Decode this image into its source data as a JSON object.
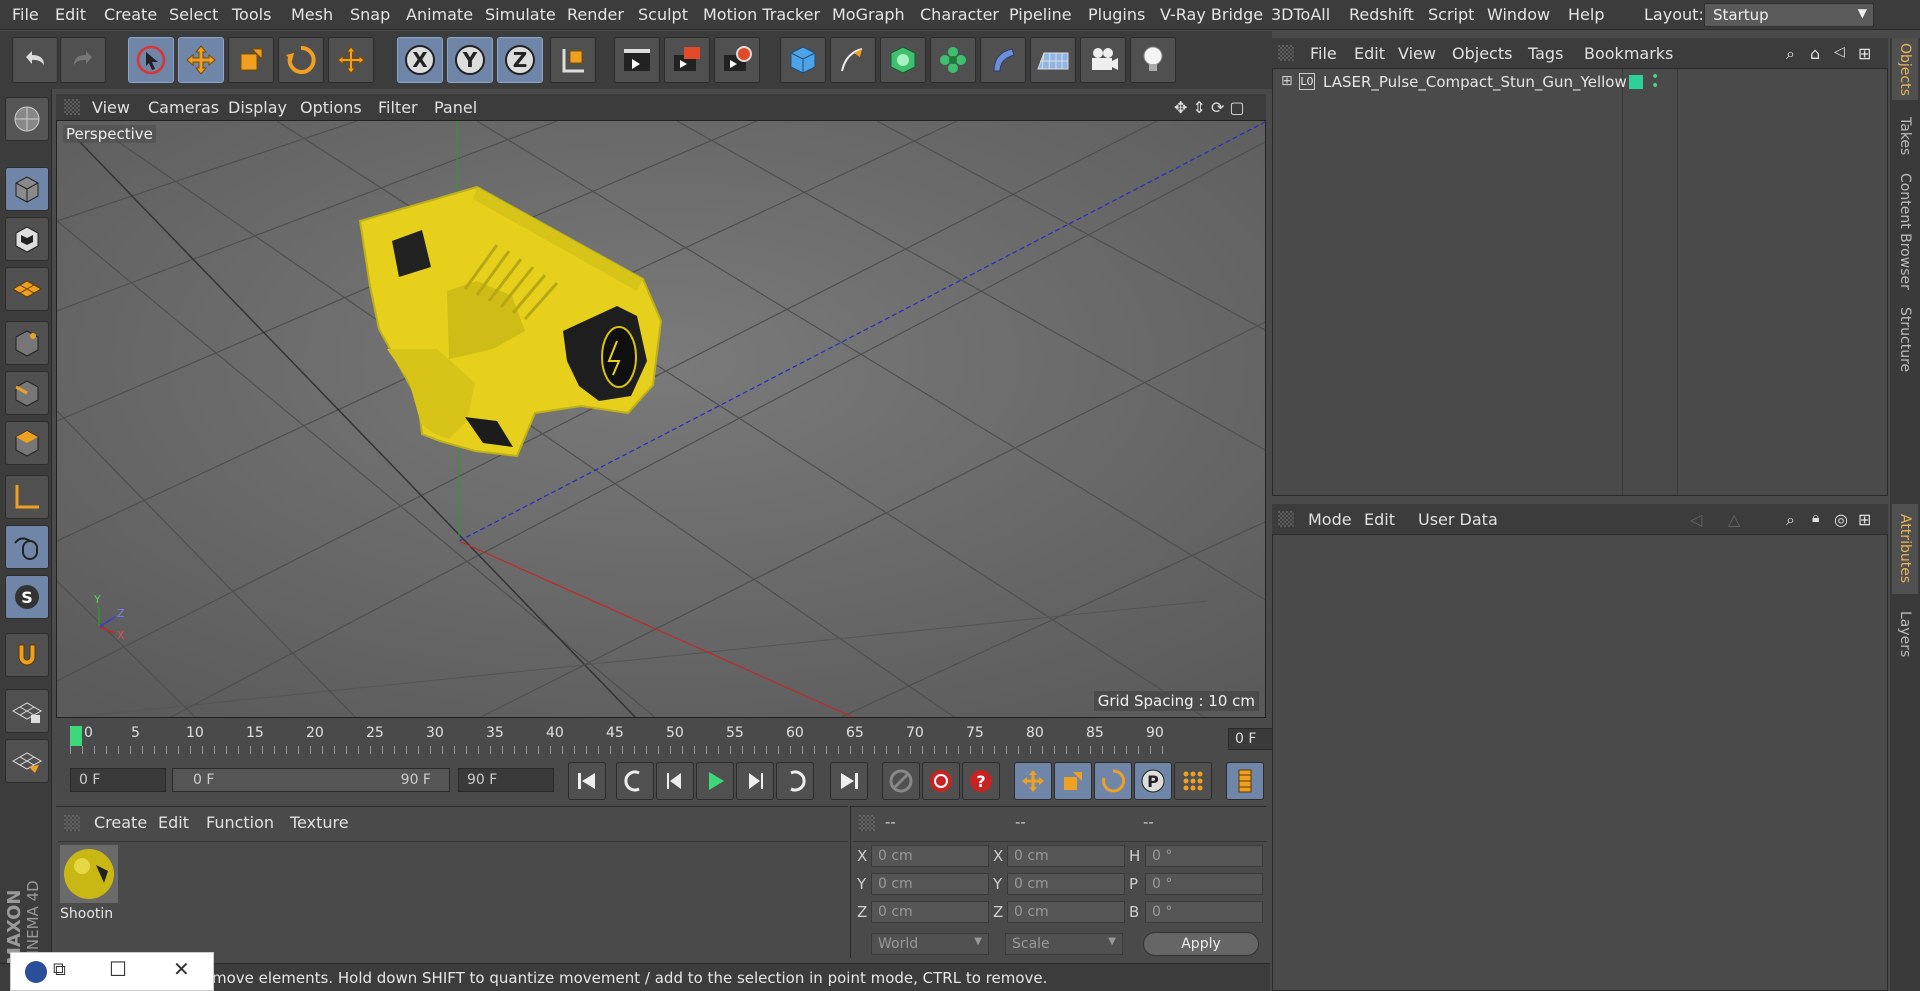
{
  "menubar": {
    "items": [
      "File",
      "Edit",
      "Create",
      "Select",
      "Tools",
      "Mesh",
      "Snap",
      "Animate",
      "Simulate",
      "Render",
      "Sculpt",
      "Motion Tracker",
      "MoGraph",
      "Character",
      "Pipeline",
      "Plugins",
      "V-Ray Bridge",
      "3DToAll",
      "Redshift",
      "Script",
      "Window",
      "Help"
    ],
    "layout_label": "Layout:",
    "layout_value": "Startup"
  },
  "toolbar": {
    "axis_x": "X",
    "axis_y": "Y",
    "axis_z": "Z"
  },
  "viewport": {
    "menu": [
      "View",
      "Cameras",
      "Display",
      "Options",
      "Filter",
      "Panel"
    ],
    "camera_label": "Perspective",
    "grid_spacing": "Grid Spacing : 10 cm",
    "axis_labels": {
      "y": "Y",
      "z": "Z",
      "x": "X"
    }
  },
  "timeline": {
    "ticks": [
      "0",
      "5",
      "10",
      "15",
      "20",
      "25",
      "30",
      "35",
      "40",
      "45",
      "50",
      "55",
      "60",
      "65",
      "70",
      "75",
      "80",
      "85",
      "90"
    ],
    "current_frame": "0 F",
    "start_field": "0 F",
    "range_start": "0 F",
    "range_end": "90 F",
    "end_field": "90 F"
  },
  "material_panel": {
    "menu": [
      "Create",
      "Edit",
      "Function",
      "Texture"
    ],
    "material_name": "Shootin"
  },
  "coord_panel": {
    "headers": [
      "--",
      "--",
      "--"
    ],
    "rows": [
      {
        "l1": "X",
        "v1": "0 cm",
        "l2": "X",
        "v2": "0 cm",
        "l3": "H",
        "v3": "0 °"
      },
      {
        "l1": "Y",
        "v1": "0 cm",
        "l2": "Y",
        "v2": "0 cm",
        "l3": "P",
        "v3": "0 °"
      },
      {
        "l1": "Z",
        "v1": "0 cm",
        "l2": "Z",
        "v2": "0 cm",
        "l3": "B",
        "v3": "0 °"
      }
    ],
    "world_label": "World",
    "scale_label": "Scale",
    "apply_label": "Apply"
  },
  "objects_panel": {
    "menu": [
      "File",
      "Edit",
      "View",
      "Objects",
      "Tags",
      "Bookmarks"
    ],
    "object_name": "LASER_Pulse_Compact_Stun_Gun_Yellow",
    "object_tag_color": "#2ed09a"
  },
  "attributes_panel": {
    "menu": [
      "Mode",
      "Edit",
      "User Data"
    ]
  },
  "right_tabs": {
    "objects": "Objects",
    "takes": "Takes",
    "content": "Content Browser",
    "structure": "Structure",
    "attributes": "Attributes",
    "layers": "Layers"
  },
  "status": {
    "text": "move elements. Hold down SHIFT to quantize movement / add to the selection in point mode, CTRL to remove."
  },
  "brand": {
    "text": "MAXON CINEMA 4D"
  },
  "colors": {
    "accent_selected": "#6f86a8",
    "model_yellow": "#e6d01c",
    "tab_active": "#e7b35a"
  }
}
